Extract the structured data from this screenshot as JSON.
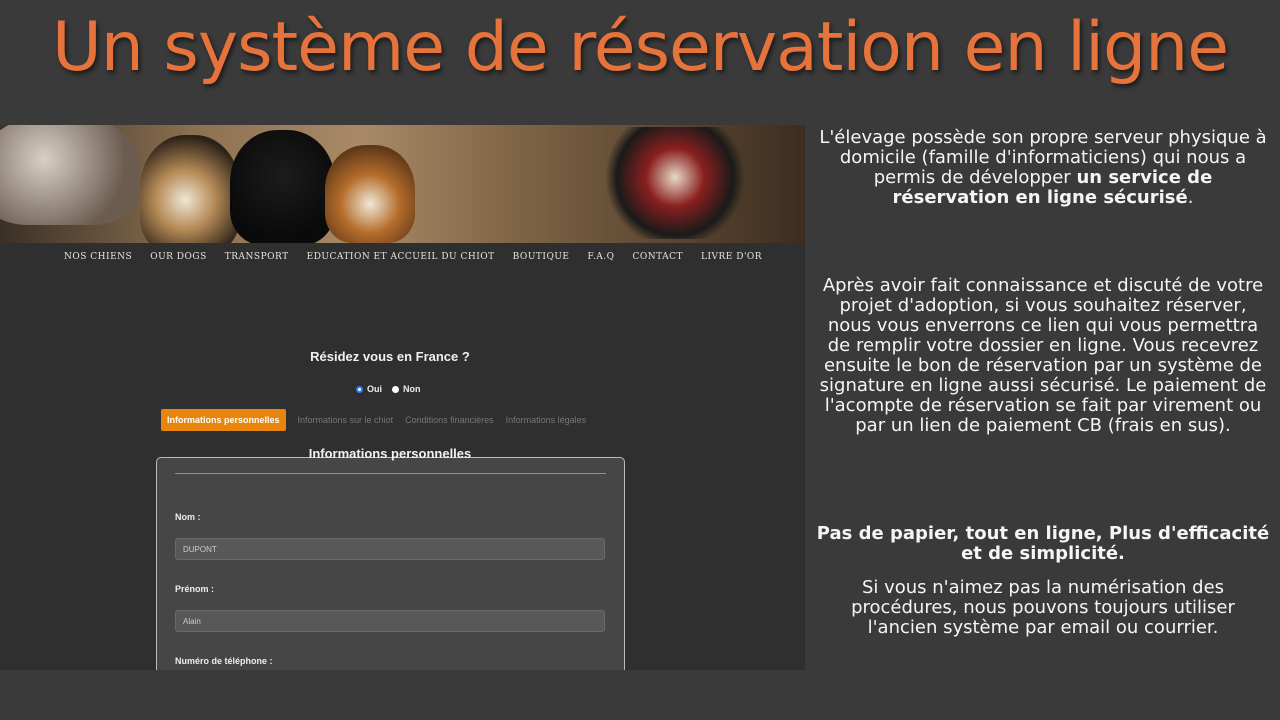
{
  "title": "Un système de réservation en ligne",
  "website": {
    "nav": [
      "NOS CHIENS",
      "OUR DOGS",
      "TRANSPORT",
      "EDUCATION ET ACCUEIL DU CHIOT",
      "BOUTIQUE",
      "F.A.Q",
      "CONTACT",
      "LIVRE D'OR"
    ],
    "question": "Résidez vous en France ?",
    "radio_yes": "Oui",
    "radio_no": "Non",
    "tabs": [
      "Informations personnelles",
      "Informations sur le chiot",
      "Conditions financières",
      "Informations légales"
    ],
    "form_title": "Informations personnelles",
    "fields": [
      {
        "label": "Nom :",
        "value": "DUPONT"
      },
      {
        "label": "Prénom :",
        "value": "Alain"
      },
      {
        "label": "Numéro de téléphone :",
        "value": ""
      }
    ]
  },
  "text": {
    "p1_start": "L'élevage possède son propre serveur physique à domicile (famille d'informaticiens) qui nous a permis de développer ",
    "p1_bold": "un service de réservation en ligne sécurisé",
    "p1_end": ".",
    "p2": "Après avoir fait connaissance et discuté de votre projet d'adoption, si vous souhaitez réserver, nous  vous enverrons ce lien qui vous permettra de remplir votre dossier en ligne. Vous recevrez ensuite le bon de réservation par un système de signature en ligne aussi sécurisé. Le paiement de l'acompte de réservation se fait par virement ou par un lien de paiement CB (frais en sus).",
    "p3": "Pas de papier, tout en ligne, Plus d'efficacité et de simplicité.",
    "p4": "Si vous n'aimez pas la numérisation des procédures, nous pouvons toujours utiliser l'ancien système par email ou courrier."
  },
  "colors": {
    "title": "#e5733b",
    "active_tab": "#e8850c",
    "background": "#3a3a3a"
  }
}
